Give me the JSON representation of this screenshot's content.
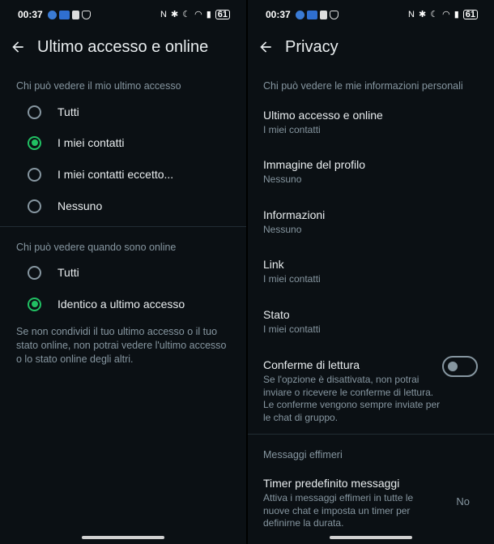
{
  "status": {
    "time": "00:37",
    "battery": "61",
    "icons_left": [
      "app-icon",
      "app-icon",
      "cast-icon",
      "shield-icon"
    ],
    "icons_right": [
      "nfc-icon",
      "bluetooth-icon",
      "moon-icon",
      "wifi-icon",
      "signal-icon",
      "battery-icon"
    ]
  },
  "left": {
    "title": "Ultimo accesso e online",
    "last_seen_label": "Chi può vedere il mio ultimo accesso",
    "last_seen_options": [
      {
        "label": "Tutti",
        "checked": false
      },
      {
        "label": "I miei contatti",
        "checked": true
      },
      {
        "label": "I miei contatti eccetto...",
        "checked": false
      },
      {
        "label": "Nessuno",
        "checked": false
      }
    ],
    "online_label": "Chi può vedere quando sono online",
    "online_options": [
      {
        "label": "Tutti",
        "checked": false
      },
      {
        "label": "Identico a ultimo accesso",
        "checked": true
      }
    ],
    "note": "Se non condividi il tuo ultimo accesso o il tuo stato online, non potrai vedere l'ultimo accesso o lo stato online degli altri."
  },
  "right": {
    "title": "Privacy",
    "section_label": "Chi può vedere le mie informazioni personali",
    "items": [
      {
        "title": "Ultimo accesso e online",
        "sub": "I miei contatti"
      },
      {
        "title": "Immagine del profilo",
        "sub": "Nessuno"
      },
      {
        "title": "Informazioni",
        "sub": "Nessuno"
      },
      {
        "title": "Link",
        "sub": "I miei contatti"
      },
      {
        "title": "Stato",
        "sub": "I miei contatti"
      }
    ],
    "read_receipts": {
      "title": "Conferme di lettura",
      "desc": "Se l'opzione è disattivata, non potrai inviare o ricevere le conferme di lettura. Le conferme vengono sempre inviate per le chat di gruppo.",
      "enabled": false
    },
    "ephemeral_label": "Messaggi effimeri",
    "timer": {
      "title": "Timer predefinito messaggi",
      "desc": "Attiva i messaggi effimeri in tutte le nuove chat e imposta un timer per definirne la durata.",
      "value": "No"
    }
  },
  "colors": {
    "accent": "#21c063",
    "background": "#0b1014",
    "secondary_text": "#8696a0"
  }
}
